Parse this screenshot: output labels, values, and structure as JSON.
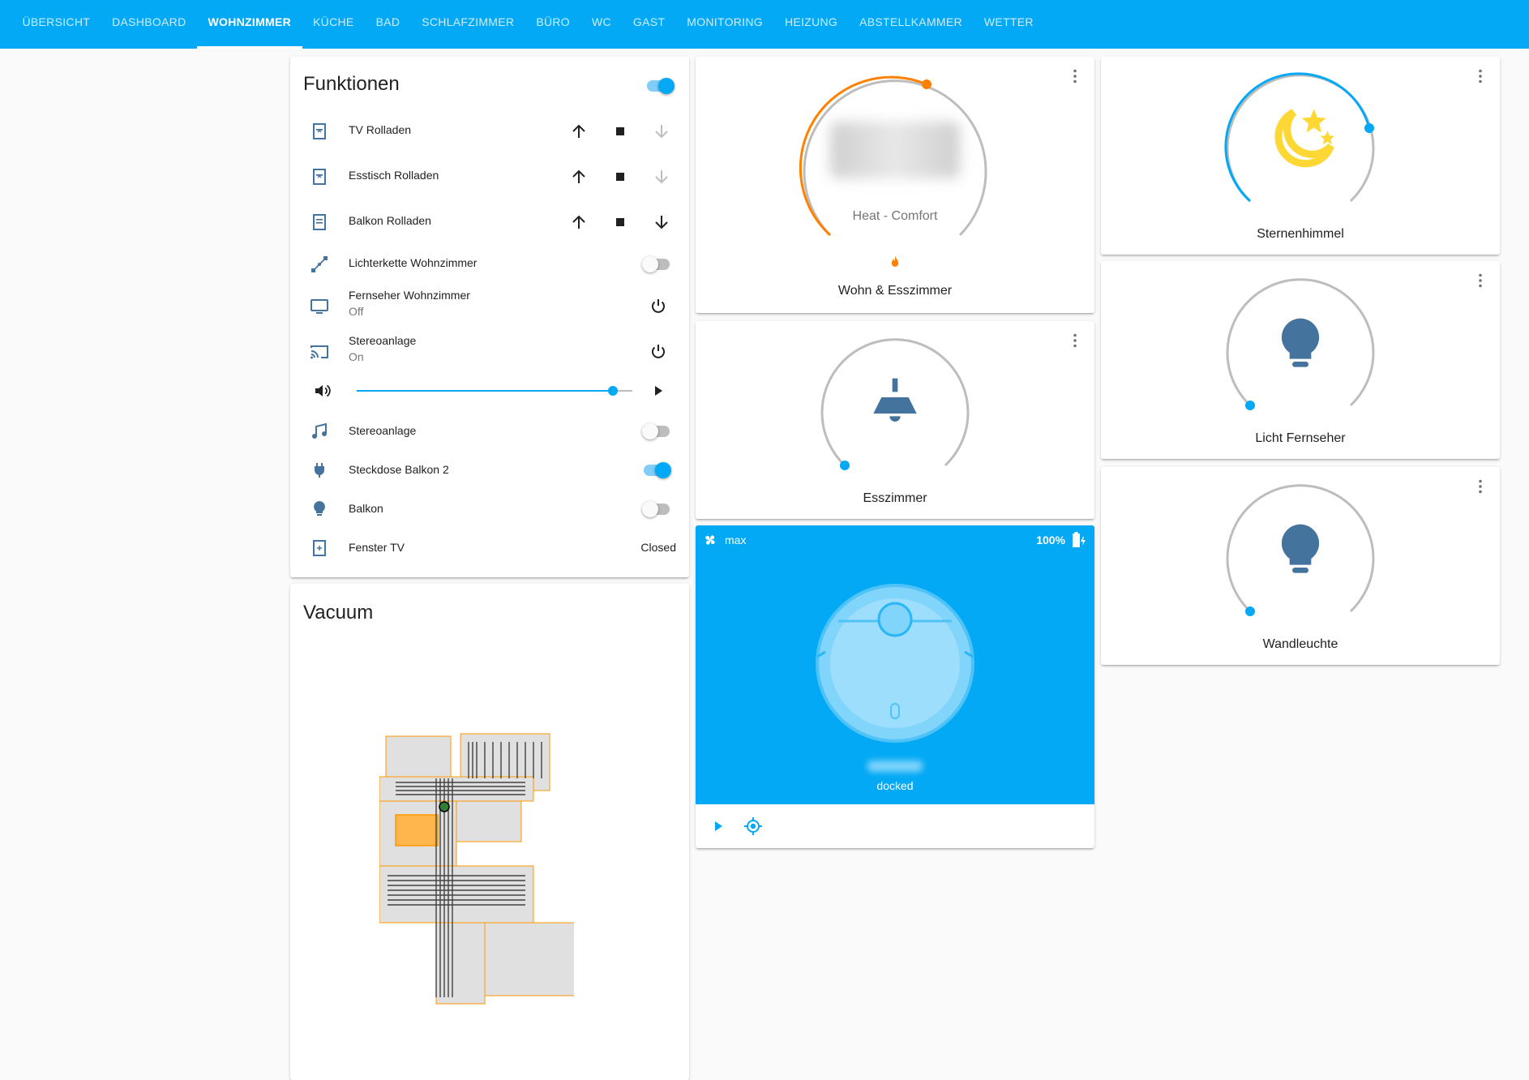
{
  "tabs": [
    {
      "label": "ÜBERSICHT"
    },
    {
      "label": "DASHBOARD"
    },
    {
      "label": "WOHNZIMMER",
      "active": true
    },
    {
      "label": "KÜCHE"
    },
    {
      "label": "BAD"
    },
    {
      "label": "SCHLAFZIMMER"
    },
    {
      "label": "BÜRO"
    },
    {
      "label": "WC"
    },
    {
      "label": "GAST"
    },
    {
      "label": "MONITORING"
    },
    {
      "label": "HEIZUNG"
    },
    {
      "label": "ABSTELLKAMMER"
    },
    {
      "label": "WETTER"
    }
  ],
  "colors": {
    "primary": "#03a9f4",
    "entity_icon": "#44739e",
    "heat": "#ff8100",
    "night": "#fdd835"
  },
  "funktionen": {
    "title": "Funktionen",
    "header_toggle": true,
    "rows": [
      {
        "label": "TV Rolladen",
        "icon": "window-shutter-icon"
      },
      {
        "label": "Esstisch Rolladen",
        "icon": "window-shutter-icon"
      },
      {
        "label": "Balkon Rolladen",
        "icon": "window-shutter-open-icon"
      },
      {
        "label": "Lichterkette Wohnzimmer",
        "icon": "string-lights-icon",
        "toggle": false
      },
      {
        "label": "Fernseher Wohnzimmer",
        "sub": "Off",
        "icon": "television-icon"
      },
      {
        "label": "Stereoanlage",
        "sub": "On",
        "icon": "cast-icon"
      },
      {
        "label": "Stereoanlage",
        "icon": "music-note-icon",
        "toggle": false
      },
      {
        "label": "Steckdose Balkon 2",
        "icon": "power-plug-icon",
        "toggle": true
      },
      {
        "label": "Balkon",
        "icon": "lightbulb-icon",
        "toggle": false
      },
      {
        "label": "Fenster TV",
        "icon": "window-icon",
        "state": "Closed"
      }
    ],
    "volume_level": 0.93
  },
  "vacuum_map": {
    "title": "Vacuum"
  },
  "thermostat": {
    "mode": "Heat - Comfort",
    "name": "Wohn & Esszimmer",
    "icon": "fire-icon"
  },
  "lights": {
    "esszimmer": {
      "name": "Esszimmer",
      "icon": "ceiling-light-icon",
      "on": true
    },
    "sternenhimmel": {
      "name": "Sternenhimmel",
      "icon": "weather-night-icon",
      "on": true
    },
    "licht_fernseher": {
      "name": "Licht Fernseher",
      "icon": "lightbulb-icon",
      "on": true
    },
    "wandleuchte": {
      "name": "Wandleuchte",
      "icon": "lightbulb-icon",
      "on": true
    }
  },
  "vacuum": {
    "fan_speed": "max",
    "battery": "100%",
    "status": "docked",
    "fan_icon": "fan-icon",
    "battery_icon": "battery-charging-icon",
    "start_icon": "play-icon",
    "locate_icon": "crosshairs-gps-icon"
  }
}
